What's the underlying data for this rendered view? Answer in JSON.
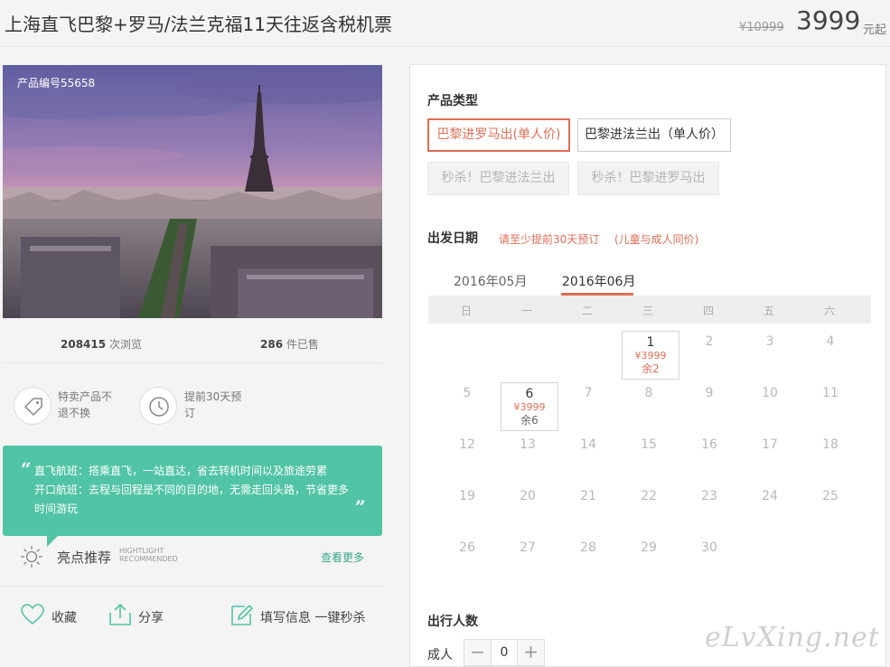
{
  "header": {
    "title": "上海直飞巴黎+罗马/法兰克福11天往返含税机票",
    "price_original": "¥10999",
    "price": "3999",
    "price_unit": "元起"
  },
  "product": {
    "code": "产品编号55658",
    "views_count": "208415",
    "views_label": "次浏览",
    "sold_count": "286",
    "sold_label": "件已售"
  },
  "features": [
    {
      "icon": "tag-icon",
      "line1": "特卖产品不",
      "line2": "退不换"
    },
    {
      "icon": "clock-icon",
      "line1": "提前30天预",
      "line2": "订"
    }
  ],
  "tips": {
    "line1": "直飞航班：搭乘直飞，一站直达，省去转机时间以及旅途劳累",
    "line2": "开口航班：去程与回程是不同的目的地，无需走回头路，节省更多",
    "line3": "时间游玩"
  },
  "highlight": {
    "title": "亮点推荐",
    "en_line1": "HIGHTLIGHT",
    "en_line2": "RECOMMENDED",
    "more": "查看更多"
  },
  "actions": {
    "favorite": "收藏",
    "share": "分享",
    "fill_info": "填写信息 一键秒杀"
  },
  "booking": {
    "type_label": "产品类型",
    "options": [
      {
        "label": "巴黎进罗马出(单人价)",
        "state": "selected"
      },
      {
        "label": "巴黎进法兰出（单人价）",
        "state": "normal"
      },
      {
        "label": "秒杀！巴黎进法兰出",
        "state": "disabled"
      },
      {
        "label": "秒杀！巴黎进罗马出",
        "state": "disabled"
      }
    ],
    "date_label": "出发日期",
    "date_note1": "请至少提前30天预订",
    "date_note2": "(儿童与成人同价)",
    "months": [
      "2016年05月",
      "2016年06月"
    ],
    "active_month": "2016年06月",
    "weekdays": [
      "日",
      "一",
      "二",
      "三",
      "四",
      "五",
      "六"
    ],
    "first_weekday": 3,
    "days_in_month": 30,
    "available_days": [
      {
        "day": 1,
        "price": "¥3999",
        "remaining": "余2",
        "remaining_color": "red"
      },
      {
        "day": 6,
        "price": "¥3999",
        "remaining": "余6",
        "remaining_color": "gray"
      }
    ],
    "travelers_label": "出行人数",
    "adult_label": "成人",
    "adult_count": "0",
    "minus": "−",
    "plus": "+"
  },
  "watermark": "eLvXing.net",
  "colors": {
    "accent": "#e06e56",
    "green": "#52c4a6",
    "link_green": "#3aa88a"
  }
}
